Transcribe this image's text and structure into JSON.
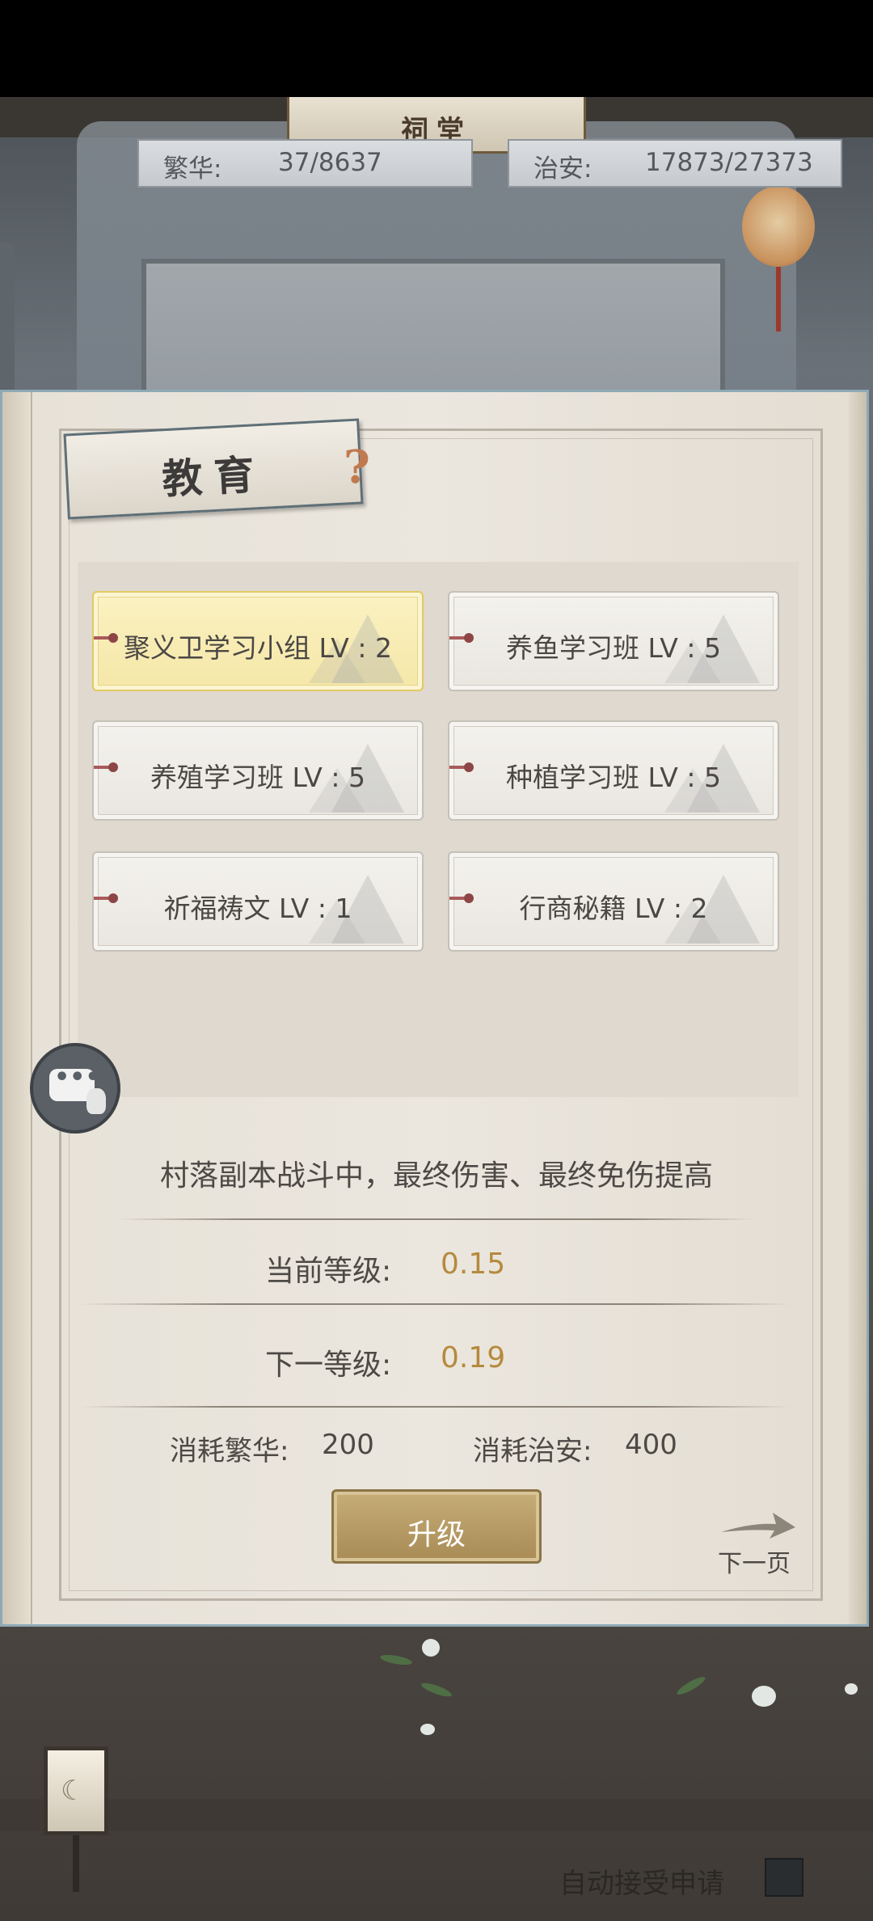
{
  "header": {
    "hall_sign": "祠堂",
    "prosperity": {
      "label": "繁华:",
      "value": "37/8637"
    },
    "security": {
      "label": "治安:",
      "value": "17873/27373"
    }
  },
  "panel": {
    "title": "教育",
    "help_icon": "question-mark-icon",
    "skills": [
      {
        "label": "聚义卫学习小组 LV : 2",
        "selected": true
      },
      {
        "label": "养鱼学习班 LV : 5",
        "selected": false
      },
      {
        "label": "养殖学习班 LV : 5",
        "selected": false
      },
      {
        "label": "种植学习班 LV : 5",
        "selected": false
      },
      {
        "label": "祈福祷文 LV : 1",
        "selected": false
      },
      {
        "label": "行商秘籍 LV : 2",
        "selected": false
      }
    ],
    "description": "村落副本战斗中，最终伤害、最终免伤提高",
    "current_level": {
      "label": "当前等级:",
      "value": "0.15"
    },
    "next_level": {
      "label": "下一等级:",
      "value": "0.19"
    },
    "cost_prosperity": {
      "label": "消耗繁华:",
      "value": "200"
    },
    "cost_security": {
      "label": "消耗治安:",
      "value": "400"
    },
    "upgrade_button": "升级",
    "next_page": "下一页"
  },
  "chat_icon": "chat-bubble-icon",
  "footer": {
    "auto_accept": "自动接受申请"
  },
  "colors": {
    "accent_gold": "#b58a3d",
    "selected_skill": "#f5e7a7",
    "upgrade_button": "#b79b63"
  }
}
